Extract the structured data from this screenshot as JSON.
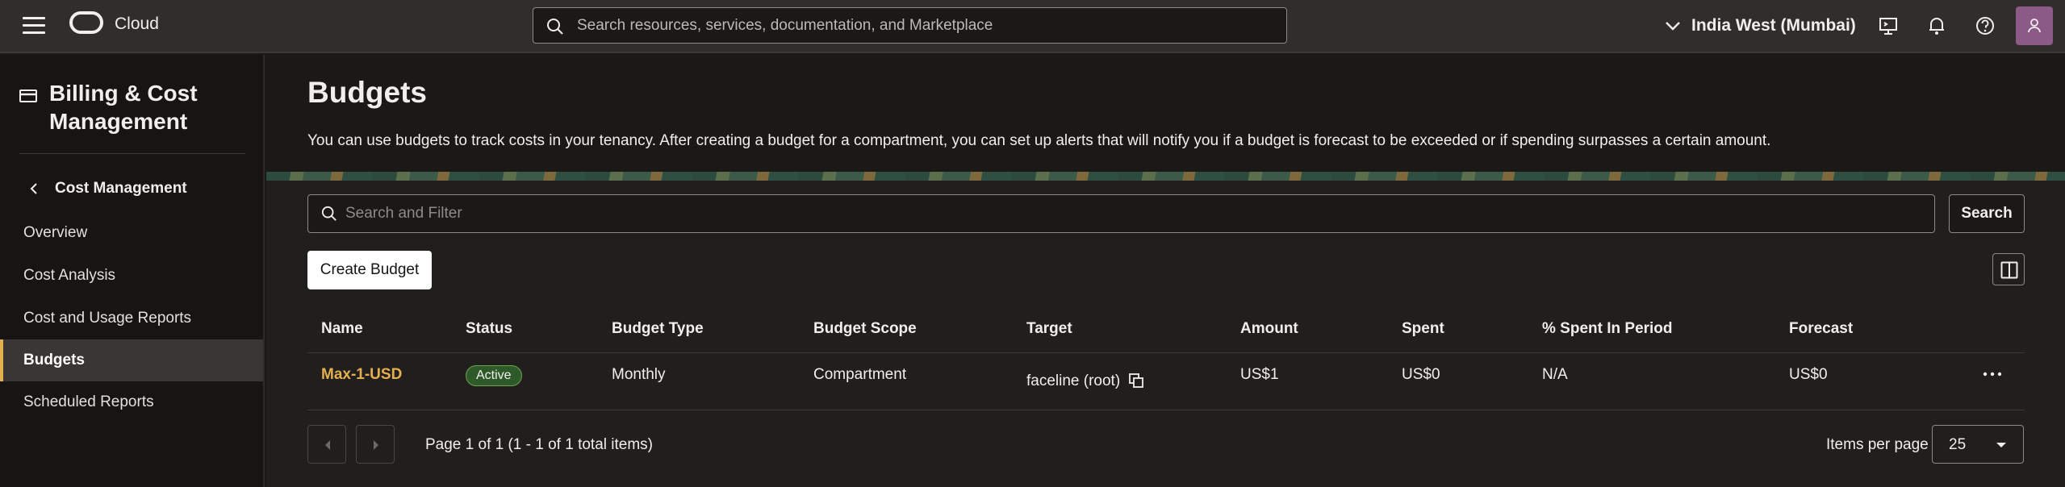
{
  "topbar": {
    "brand": "Cloud",
    "search_placeholder": "Search resources, services, documentation, and Marketplace",
    "region": "India West (Mumbai)",
    "icons": [
      "menu-icon",
      "oracle-logo",
      "search-icon",
      "chevron-down-icon",
      "cloud-shell-icon",
      "bell-icon",
      "help-icon",
      "user-icon"
    ]
  },
  "sidebar": {
    "title": "Billing & Cost Management",
    "back_label": "Cost Management",
    "items": [
      {
        "label": "Overview",
        "active": false
      },
      {
        "label": "Cost Analysis",
        "active": false
      },
      {
        "label": "Cost and Usage Reports",
        "active": false
      },
      {
        "label": "Budgets",
        "active": true
      },
      {
        "label": "Scheduled Reports",
        "active": false
      }
    ]
  },
  "main": {
    "title": "Budgets",
    "description": "You can use budgets to track costs in your tenancy. After creating a budget for a compartment, you can set up alerts that will notify you if a budget is forecast to be exceeded or if spending surpasses a certain amount.",
    "filter_placeholder": "Search and Filter",
    "search_button": "Search",
    "create_button": "Create Budget"
  },
  "table": {
    "columns": [
      "Name",
      "Status",
      "Budget Type",
      "Budget Scope",
      "Target",
      "Amount",
      "Spent",
      "% Spent In Period",
      "Forecast"
    ],
    "rows": [
      {
        "name": "Max-1-USD",
        "status": "Active",
        "budget_type": "Monthly",
        "budget_scope": "Compartment",
        "target": "faceline (root)",
        "amount": "US$1",
        "spent": "US$0",
        "pct_spent": "N/A",
        "forecast": "US$0"
      }
    ]
  },
  "pagination": {
    "summary": "Page 1 of 1 (1 - 1 of 1 total items)",
    "items_per_page_label": "Items per page",
    "items_per_page": "25"
  },
  "colors": {
    "accent": "#e4b04f",
    "topbar_bg": "#312d2a",
    "status_active": "#2e5a2a"
  }
}
